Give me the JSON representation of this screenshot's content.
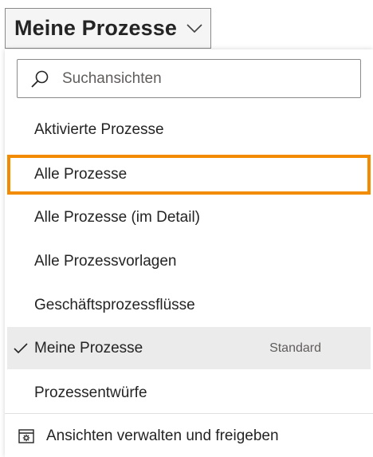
{
  "view_selector": {
    "label": "Meine Prozesse",
    "chevron_icon": "chevron-down-icon"
  },
  "flyout": {
    "search": {
      "icon": "search-icon",
      "placeholder": "Suchansichten",
      "value": ""
    },
    "items": [
      {
        "label": "Aktivierte Prozesse",
        "selected": false,
        "highlighted": false,
        "badge": ""
      },
      {
        "label": "Alle Prozesse",
        "selected": false,
        "highlighted": true,
        "badge": ""
      },
      {
        "label": "Alle Prozesse (im Detail)",
        "selected": false,
        "highlighted": false,
        "badge": ""
      },
      {
        "label": "Alle Prozessvorlagen",
        "selected": false,
        "highlighted": false,
        "badge": ""
      },
      {
        "label": "Geschäftsprozessflüsse",
        "selected": false,
        "highlighted": false,
        "badge": ""
      },
      {
        "label": "Meine Prozesse",
        "selected": true,
        "highlighted": false,
        "badge": "Standard"
      },
      {
        "label": "Prozessentwürfe",
        "selected": false,
        "highlighted": false,
        "badge": ""
      }
    ],
    "manage": {
      "icon": "settings-view-icon",
      "label": "Ansichten verwalten und freigeben"
    }
  },
  "colors": {
    "highlight_border": "#f38b00",
    "selected_background": "#ebebeb",
    "text": "#242424",
    "muted_text": "#605e5c"
  }
}
